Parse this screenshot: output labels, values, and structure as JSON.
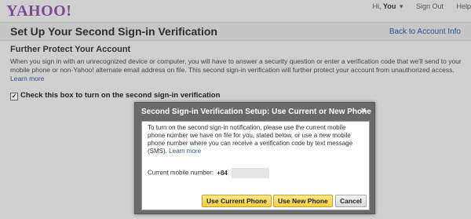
{
  "logo": {
    "text": "YAHOO!"
  },
  "topnav": {
    "greeting": "Hi,",
    "user": "You",
    "sign_out": "Sign Out",
    "help": "Help"
  },
  "page": {
    "title": "Set Up Your Second Sign-in Verification",
    "back_link": "Back to Account Info"
  },
  "section": {
    "title": "Further Protect Your Account",
    "description": "When you sign in with an unrecognized device or computer, you will have to answer a security question or enter a verification code that we'll send to your mobile phone or non-Yahoo! alternate email address on file. This second sign-in verification will further protect your account from unauthorized access.",
    "learn_more": "Learn more"
  },
  "checkbox": {
    "label": "Check this box to turn on the second sign-in verification",
    "checked_glyph": "✓"
  },
  "modal": {
    "title": "Second Sign-in Verification Setup: Use Current or New Phone",
    "close_glyph": "×",
    "message": "To turn on the second sign-in notification, please use the current mobile phone number we have on file for you, stated below, or use a new mobile phone number where you can receive a verification code by text message (SMS).",
    "learn_more": "Learn more",
    "mobile_label": "Current mobile number:",
    "country_code": "+84",
    "buttons": {
      "use_current": "Use Current Phone",
      "use_new": "Use New Phone",
      "cancel": "Cancel"
    }
  },
  "colors": {
    "brand": "#7a4b94",
    "link": "#2f4f8f",
    "primary_button": "#f6cf3d"
  }
}
